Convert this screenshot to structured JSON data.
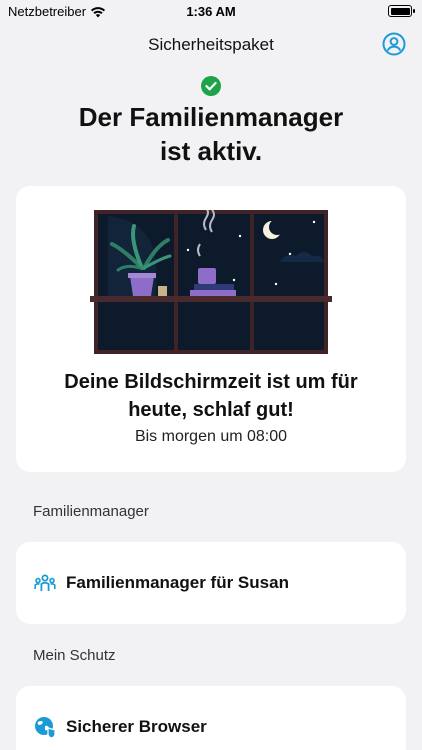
{
  "status_bar": {
    "carrier": "Netzbetreiber",
    "time": "1:36 AM"
  },
  "nav": {
    "title": "Sicherheitspaket"
  },
  "hero": {
    "title_line1": "Der Familienmanager",
    "title_line2": "ist aktiv."
  },
  "bedtime_card": {
    "heading_line1": "Deine Bildschirmzeit ist um für",
    "heading_line2": "heute, schlaf gut!",
    "subtext": "Bis morgen um 08:00"
  },
  "sections": {
    "family_label": "Familienmanager",
    "family_item": "Familienmanager für Susan",
    "protection_label": "Mein Schutz",
    "browser_item": "Sicherer Browser"
  },
  "colors": {
    "accent": "#1a9bd7",
    "success": "#1fa34a",
    "night_sky": "#0d1a2c",
    "window_frame": "#3e2426"
  }
}
